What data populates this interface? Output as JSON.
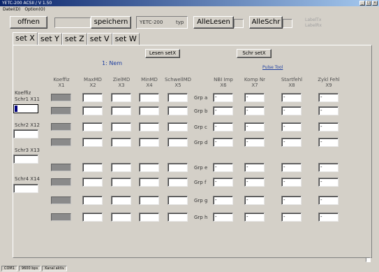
{
  "window": {
    "title": "YETC-200 ACSII / V 1.50"
  },
  "menu": [
    "Datei(D)",
    "Option(O)"
  ],
  "toolbar": {
    "open_label": "offnen",
    "save_label": "speichern",
    "device": "YETC-200",
    "type_label": "typ",
    "read_all_label": "AlleLesen",
    "write_all_label": "AlleSchr",
    "label_tx": "LabelTx",
    "label_rx": "LabelRx"
  },
  "tabs": [
    "set X",
    "set Y",
    "set Z",
    "set V",
    "set W"
  ],
  "panel": {
    "read_button": "Lesen setX",
    "write_button": "Schr setX",
    "mode_label": "1: Nem",
    "pulse_link": "Pulse Tool",
    "koeffiz_label_1": "Koeffiz",
    "koeffiz_label_2": "Schr1 X11",
    "schr_labels": [
      "Schr2 X12",
      "Schr3 X13",
      "Schr4 X14"
    ],
    "columns": [
      {
        "name": "Koeffiz",
        "code": "X1"
      },
      {
        "name": "MaxMD",
        "code": "X2"
      },
      {
        "name": "ZielMD",
        "code": "X3"
      },
      {
        "name": "MinMD",
        "code": "X4"
      },
      {
        "name": "SchwellMD",
        "code": "X5"
      },
      {
        "name": "NBI Imp",
        "code": "X6"
      },
      {
        "name": "Komp Nr",
        "code": "X7"
      },
      {
        "name": "Startfehl",
        "code": "X8"
      },
      {
        "name": "Zykl Fehl",
        "code": "X9"
      }
    ],
    "groups": [
      "Grp a",
      "Grp b",
      "Grp c",
      "Grp d",
      "Grp e",
      "Grp f",
      "Grp g",
      "Grp h"
    ],
    "field_value": "-"
  },
  "statusbar": [
    "COM1",
    "9600 bps",
    "Kanal aktiv"
  ]
}
